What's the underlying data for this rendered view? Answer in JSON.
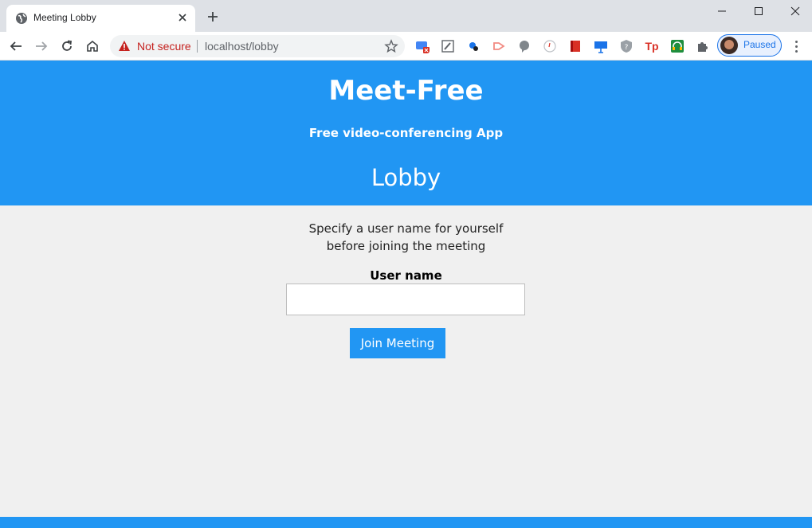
{
  "browser": {
    "tab_title": "Meeting Lobby",
    "not_secure": "Not secure",
    "url": "localhost/lobby",
    "profile_status": "Paused",
    "extensions": [
      "translate-ext-icon",
      "pen-ext-icon",
      "bug-ext-icon",
      "arrow-ext-icon",
      "chat-ext-icon",
      "clock-ext-icon",
      "book-ext-icon",
      "presentation-ext-icon",
      "shield-ext-icon",
      "tp-ext-icon",
      "headphones-ext-icon",
      "puzzle-icon"
    ],
    "tp_label": "Tp"
  },
  "header": {
    "title": "Meet-Free",
    "subtitle": "Free video-conferencing App",
    "page_heading": "Lobby"
  },
  "lobby": {
    "instructions_line1": "Specify a user name for yourself",
    "instructions_line2": "before joining the meeting",
    "username_label": "User name",
    "username_value": "",
    "join_label": "Join Meeting"
  },
  "colors": {
    "primary": "#2196f3",
    "background": "#f0f0f0",
    "warning": "#c5221f"
  }
}
